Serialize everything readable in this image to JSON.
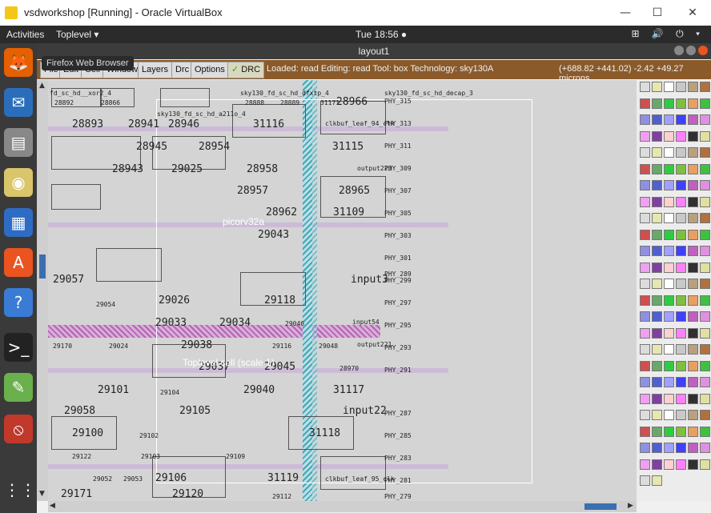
{
  "window": {
    "title": "vsdworkshop [Running] - Oracle VirtualBox"
  },
  "gnome": {
    "activities": "Activities",
    "app_menu": "Toplevel ▾",
    "clock": "Tue 18:56 ●",
    "tray": "⊞ 🔊 ⏻ ▾"
  },
  "tooltip": "Firefox Web Browser",
  "layout_window": {
    "title": "layout1"
  },
  "menus": [
    "File",
    "Edit",
    "Cell",
    "Window",
    "Layers",
    "Drc",
    "Options"
  ],
  "drc_label": "DRC",
  "status": {
    "loaded": "Loaded: read Editing: read Tool: box Technology: sky130A",
    "coords": "(+688.82 +441.02) -2.42 +49.27 microns"
  },
  "canvas": {
    "center_label": "Toplevel cell (scale 1)",
    "picorv_label": "picorv32a",
    "labels_big": [
      "28893",
      "28941",
      "28946",
      "31116",
      "28945",
      "28954",
      "31115",
      "28943",
      "29025",
      "28958",
      "28957",
      "28965",
      "28962",
      "31109",
      "29043",
      "29057",
      "input3",
      "29026",
      "29118",
      "29033",
      "29034",
      "29038",
      "29037",
      "29045",
      "29101",
      "29040",
      "31117",
      "29058",
      "29105",
      "input22",
      "29100",
      "31118",
      "29106",
      "31119",
      "29171",
      "29120",
      "28966"
    ],
    "labels_small": [
      "fd_sc_hd__xor2_4",
      "sky130_fd_sc_hd_dfxtp_4",
      "sky130_fd_sc_hd_a211o_4",
      "sky130_fd_sc_hd_decap_3",
      "PHY_315",
      "clkbuf_leaf_94_clk",
      "PHY_313",
      "PHY_311",
      "PHY_309",
      "PHY_307",
      "PHY_305",
      "PHY_303",
      "PHY_301",
      "PHY_299",
      "PHY_297",
      "PHY_295",
      "PHY_293",
      "PHY_291",
      "PHY_289",
      "PHY_287",
      "PHY_285",
      "PHY_283",
      "PHY_281",
      "PHY_279",
      "clkbuf_leaf_95_clk",
      "input54",
      "output221",
      "output223",
      "28892",
      "28866",
      "28888",
      "28889",
      "31171",
      "28970",
      "29170",
      "29024",
      "29054",
      "29104",
      "29122",
      "29052",
      "29053",
      "29102",
      "29103",
      "29109",
      "29112",
      "29116",
      "29048",
      "29046"
    ]
  },
  "colors": {
    "menubar": "#8a5a2b",
    "gnome": "#2b2b2b",
    "dock": "#3a3a3a"
  }
}
